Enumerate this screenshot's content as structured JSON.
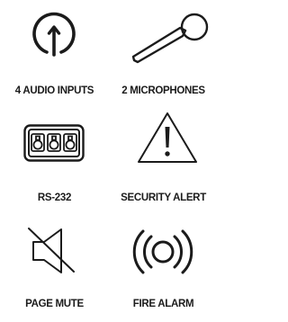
{
  "colors": {
    "ink": "#1b1b1b"
  },
  "features": [
    {
      "label": "4 AUDIO INPUTS",
      "icon": "power-plug-icon"
    },
    {
      "label": "2 MICROPHONES",
      "icon": "microphone-icon"
    },
    {
      "label": "RS-232",
      "icon": "serial-port-icon"
    },
    {
      "label": "SECURITY ALERT",
      "icon": "warning-triangle-icon"
    },
    {
      "label": "PAGE MUTE",
      "icon": "speaker-muted-icon"
    },
    {
      "label": "FIRE ALARM",
      "icon": "alarm-siren-icon"
    }
  ]
}
